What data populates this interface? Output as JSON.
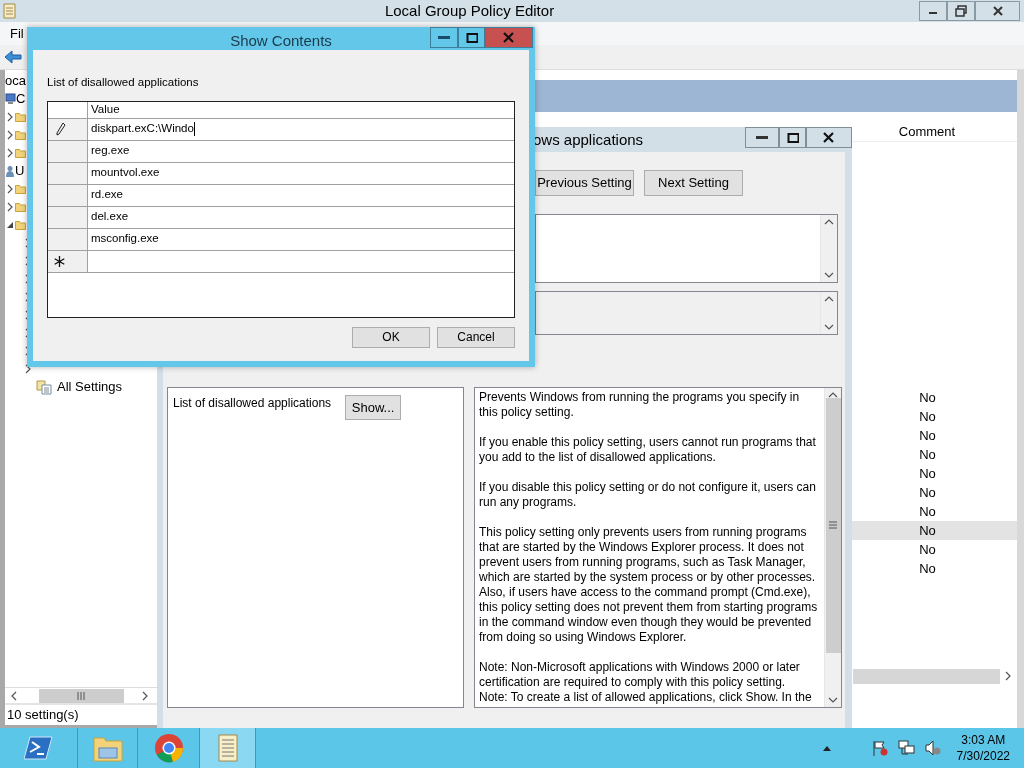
{
  "main_window": {
    "title": "Local Group Policy Editor",
    "menu": [
      {
        "label": "Fil"
      }
    ],
    "tree": [
      {
        "label": "oca",
        "children": [
          {
            "label": "C",
            "kind": "computer",
            "children": [
              {
                "kind": "folder",
                "expanded": false
              },
              {
                "kind": "folder",
                "expanded": false
              },
              {
                "kind": "folder",
                "expanded": false
              }
            ]
          },
          {
            "label": "U",
            "kind": "user",
            "children": [
              {
                "kind": "folder",
                "expanded": false
              },
              {
                "kind": "folder",
                "expanded": false
              },
              {
                "kind": "folder",
                "expanded": true,
                "children": [
                  {
                    "kind": "folder",
                    "expanded": false
                  },
                  {
                    "kind": "folder",
                    "expanded": false
                  },
                  {
                    "kind": "folder",
                    "expanded": false
                  },
                  {
                    "kind": "folder",
                    "expanded": false
                  },
                  {
                    "kind": "folder",
                    "expanded": false
                  },
                  {
                    "kind": "folder",
                    "expanded": false
                  },
                  {
                    "kind": "folder",
                    "expanded": false
                  },
                  {
                    "kind": "folder",
                    "expanded": false
                  },
                  {
                    "label": "All Settings",
                    "kind": "settings"
                  }
                ]
              }
            ]
          }
        ]
      }
    ],
    "status": "10 setting(s)",
    "list": {
      "columns": [
        "Comment"
      ],
      "rows": [
        {
          "comment": "No",
          "selected": false
        },
        {
          "comment": "No",
          "selected": false
        },
        {
          "comment": "No",
          "selected": false
        },
        {
          "comment": "No",
          "selected": false
        },
        {
          "comment": "No",
          "selected": false
        },
        {
          "comment": "No",
          "selected": false
        },
        {
          "comment": "No",
          "selected": false
        },
        {
          "comment": "No",
          "selected": true
        },
        {
          "comment": "No",
          "selected": false
        },
        {
          "comment": "No",
          "selected": false
        }
      ]
    }
  },
  "policy_window": {
    "title": "ows applications",
    "buttons": [
      "Previous Setting",
      "Next Setting"
    ],
    "options": {
      "label": "List of disallowed applications",
      "button": "Show..."
    },
    "help": [
      "Prevents Windows from running the programs you specify in this policy setting.",
      "If you enable this policy setting, users cannot run programs that you add to the list of disallowed applications.",
      "If you disable this policy setting or do not configure it, users can run any programs.",
      "This policy setting only prevents users from running programs that are started by the Windows Explorer process. It does not prevent users from running programs, such as Task Manager, which are started by the system process or by other processes. Also, if users have access to the command prompt (Cmd.exe), this policy setting does not prevent them from starting programs in the command window even though they would be prevented from doing so using Windows Explorer.",
      "Note: Non-Microsoft applications with Windows 2000 or later certification are required to comply with this policy setting.\nNote: To create a list of allowed applications, click Show.  In the"
    ]
  },
  "dialog": {
    "title": "Show Contents",
    "label": "List of disallowed applications",
    "column": "Value",
    "rows": [
      {
        "kind": "value",
        "value": "diskpart.exC:\\Windo",
        "editing": true
      },
      {
        "kind": "value",
        "value": "reg.exe",
        "editing": false
      },
      {
        "kind": "value",
        "value": "mountvol.exe",
        "editing": false
      },
      {
        "kind": "value",
        "value": "rd.exe",
        "editing": false
      },
      {
        "kind": "value",
        "value": "del.exe",
        "editing": false
      },
      {
        "kind": "value",
        "value": "msconfig.exe",
        "editing": false
      },
      {
        "kind": "new"
      }
    ],
    "buttons": [
      "OK",
      "Cancel"
    ]
  },
  "taskbar": {
    "apps": [
      {
        "kind": "powershell",
        "selected": false
      },
      {
        "kind": "explorer",
        "selected": false
      },
      {
        "kind": "chrome",
        "selected": false
      },
      {
        "kind": "notepad",
        "selected": true
      }
    ],
    "time": "3:03 AM",
    "date": "7/30/2022"
  }
}
